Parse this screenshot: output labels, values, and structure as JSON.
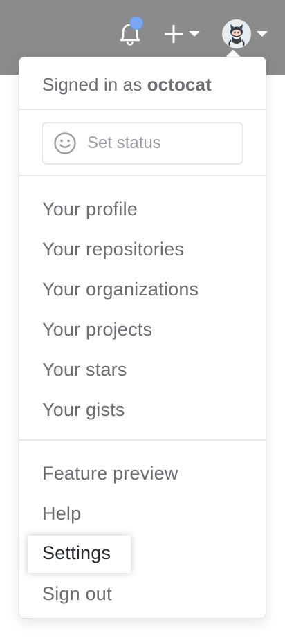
{
  "header": {
    "bell_icon": "bell-icon",
    "plus_icon": "plus-icon",
    "avatar_icon": "octocat-avatar",
    "caret_icon": "caret-down-icon"
  },
  "menu": {
    "signed_in_prefix": "Signed in as ",
    "username": "octocat",
    "set_status_label": "Set status",
    "set_status_icon": "smiley-icon",
    "items_group1": [
      "Your profile",
      "Your repositories",
      "Your organizations",
      "Your projects",
      "Your stars",
      "Your gists"
    ],
    "items_group2": [
      "Feature preview",
      "Help",
      "Settings",
      "Sign out"
    ],
    "highlighted_item": "Settings"
  },
  "colors": {
    "topbar": "#8b8b8c",
    "notification_dot": "#7aa6f2",
    "menu_text": "#6a6e73",
    "highlight_text": "#24292e"
  }
}
